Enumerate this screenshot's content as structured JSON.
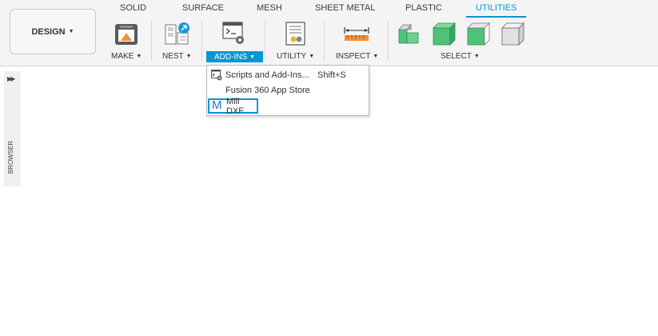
{
  "workspace": {
    "label": "DESIGN"
  },
  "tabs": [
    {
      "label": "SOLID"
    },
    {
      "label": "SURFACE"
    },
    {
      "label": "MESH"
    },
    {
      "label": "SHEET METAL"
    },
    {
      "label": "PLASTIC"
    },
    {
      "label": "UTILITIES",
      "active": true
    }
  ],
  "groups": {
    "make": "MAKE",
    "nest": "NEST",
    "addins": "ADD-INS",
    "utility": "UTILITY",
    "inspect": "INSPECT",
    "select": "SELECT"
  },
  "addins_menu": {
    "items": [
      {
        "label": "Scripts and Add-Ins...",
        "shortcut": "Shift+S",
        "icon": "scripts-icon"
      },
      {
        "label": "Fusion 360 App Store",
        "shortcut": ""
      },
      {
        "label": "Mill DXF",
        "icon": "mill-dxf-icon",
        "selected": true
      }
    ]
  },
  "browser": {
    "label": "BROWSER"
  },
  "colors": {
    "accent": "#0696d7",
    "select_green": "#4ec279"
  }
}
